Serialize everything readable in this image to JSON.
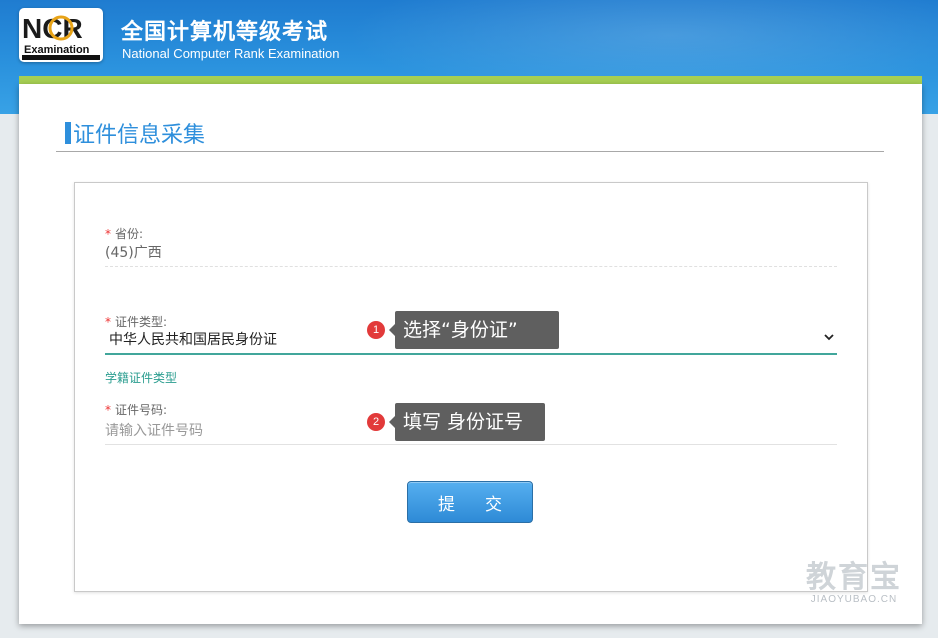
{
  "header": {
    "logo": {
      "letters": "NCR",
      "sub": "Examination",
      "tiny": "全国计算机等级考试"
    },
    "title_cn": "全国计算机等级考试",
    "title_en": "National Computer Rank Examination"
  },
  "page": {
    "section_title": "证件信息采集"
  },
  "form": {
    "required_mark": "*",
    "province": {
      "label": "省份:",
      "value": "(45)广西"
    },
    "id_type": {
      "label": "证件类型:",
      "selected": "中华人民共和国居民身份证",
      "options": [
        "中华人民共和国居民身份证"
      ]
    },
    "school_link": "学籍证件类型",
    "id_number": {
      "label": "证件号码:",
      "placeholder": "请输入证件号码",
      "value": ""
    },
    "submit_label": "提交"
  },
  "annotations": [
    {
      "number": "1",
      "text": "选择“身份证”"
    },
    {
      "number": "2",
      "text": "填写 身份证号"
    }
  ],
  "watermark": {
    "cn": "教育宝",
    "en": "JIAOYUBAO.CN"
  },
  "colors": {
    "header_blue": "#2a91dd",
    "accent_green": "#a6cf53",
    "title_blue": "#2e8fdc",
    "teal": "#41a69b",
    "badge_red": "#e23a3a"
  }
}
